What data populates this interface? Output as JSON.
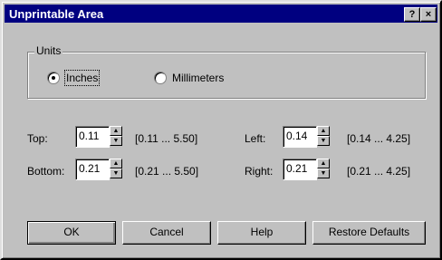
{
  "window": {
    "title": "Unprintable Area",
    "help_btn": "?",
    "close_btn": "×"
  },
  "units": {
    "group_label": "Units",
    "options": [
      {
        "label": "Inches",
        "selected": true
      },
      {
        "label": "Millimeters",
        "selected": false
      }
    ]
  },
  "margins": {
    "top": {
      "label": "Top:",
      "value": "0.11",
      "range": "[0.11 ... 5.50]"
    },
    "bottom": {
      "label": "Bottom:",
      "value": "0.21",
      "range": "[0.21 ... 5.50]"
    },
    "left": {
      "label": "Left:",
      "value": "0.14",
      "range": "[0.14 ... 4.25]"
    },
    "right": {
      "label": "Right:",
      "value": "0.21",
      "range": "[0.21 ... 4.25]"
    }
  },
  "buttons": {
    "ok": "OK",
    "cancel": "Cancel",
    "help": "Help",
    "restore": "Restore Defaults"
  },
  "icons": {
    "spin_up": "up-arrow",
    "spin_down": "down-arrow",
    "radio": "radio-dot"
  }
}
